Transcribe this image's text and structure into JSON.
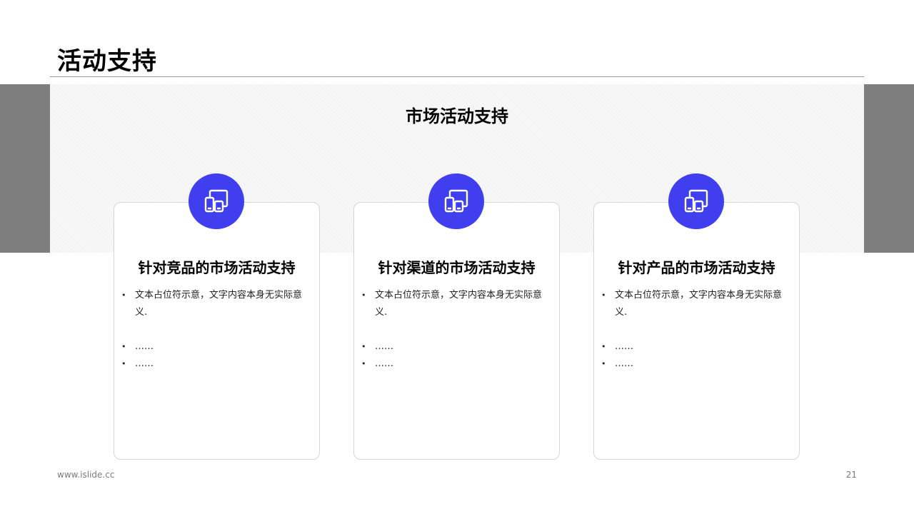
{
  "page": {
    "title": "活动支持",
    "section_title": "市场活动支持",
    "footer_url": "www.islide.cc",
    "page_number": "21"
  },
  "colors": {
    "accent": "#3f3ff0",
    "side_bar": "#7f7f7f",
    "band": "#f7f7f7"
  },
  "cards": [
    {
      "icon": "devices-icon",
      "title": "针对竞品的市场活动支持",
      "bullets": [
        "文本占位符示意，文字内容本身无实际意义.",
        "……",
        "……"
      ]
    },
    {
      "icon": "devices-icon",
      "title": "针对渠道的市场活动支持",
      "bullets": [
        "文本占位符示意，文字内容本身无实际意义.",
        "……",
        "……"
      ]
    },
    {
      "icon": "devices-icon",
      "title": "针对产品的市场活动支持",
      "bullets": [
        "文本占位符示意，文字内容本身无实际意义.",
        "……",
        "……"
      ]
    }
  ]
}
